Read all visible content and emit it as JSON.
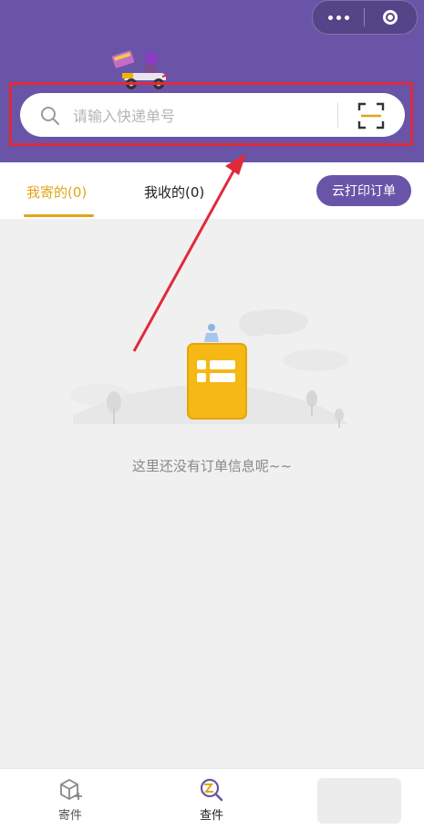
{
  "search": {
    "placeholder": "请输入快递单号"
  },
  "tabs": [
    {
      "label": "我寄的(0)",
      "active": true
    },
    {
      "label": "我收的(0)",
      "active": false
    }
  ],
  "cloud_print_label": "云打印订单",
  "empty_text": "这里还没有订单信息呢~~",
  "tabbar": [
    {
      "label": "寄件",
      "icon": "box-plus-icon"
    },
    {
      "label": "查件",
      "icon": "search-package-icon"
    }
  ],
  "colors": {
    "header": "#6a54a8",
    "accent": "#e3a419",
    "annotation": "#e02a3a"
  }
}
